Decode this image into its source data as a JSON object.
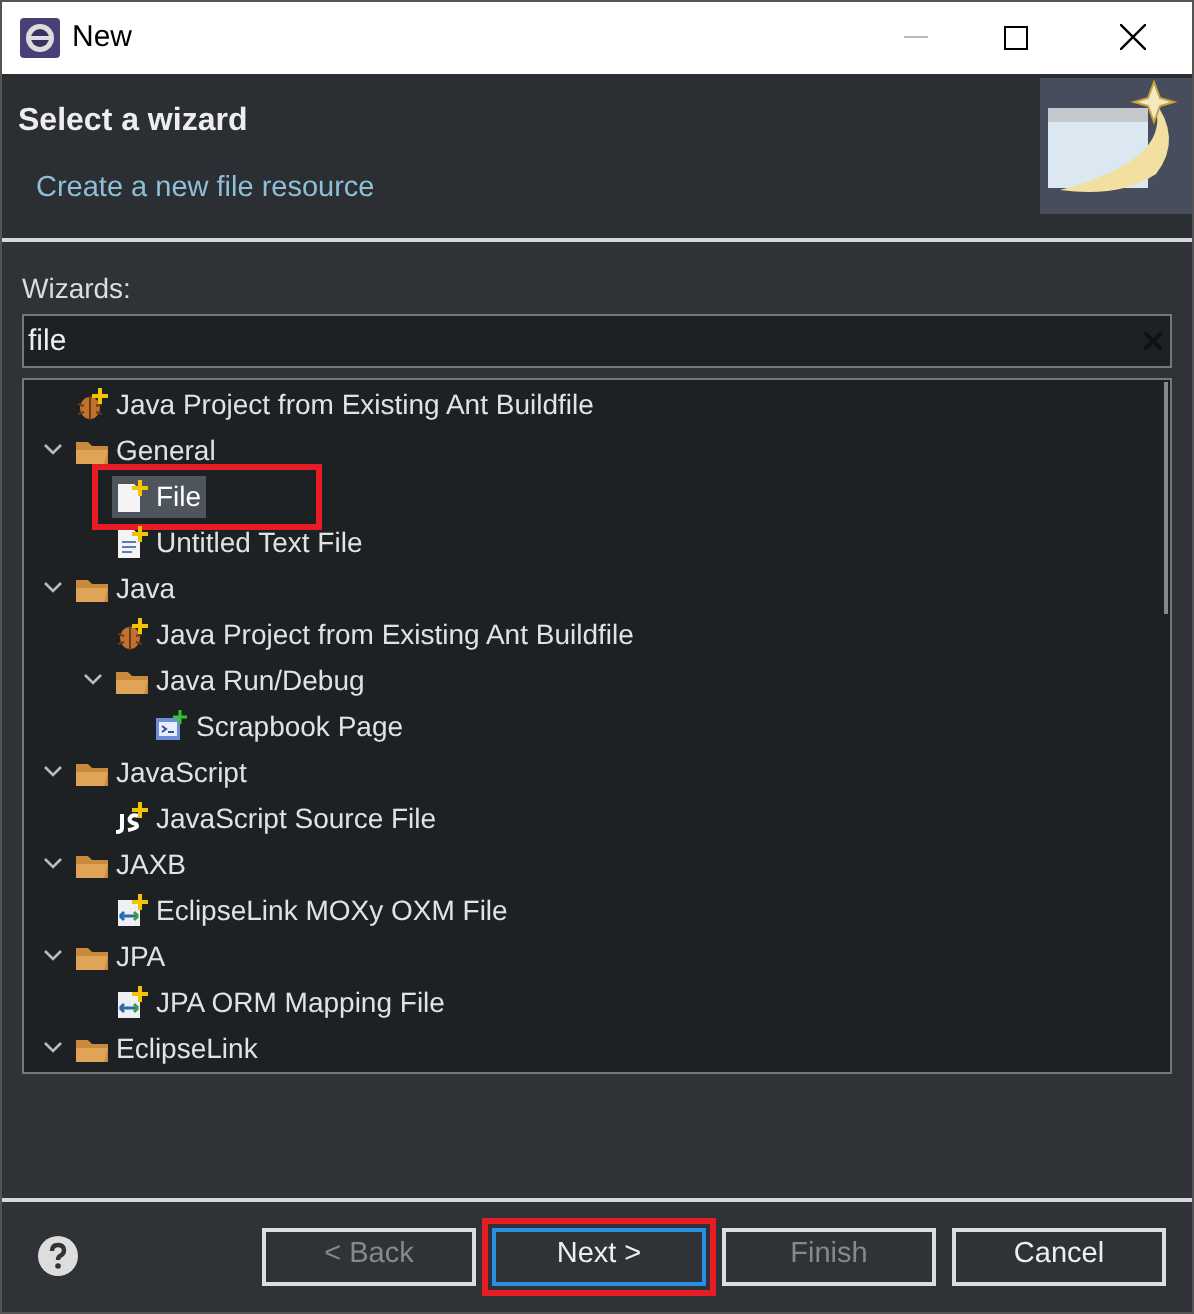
{
  "window": {
    "title": "New"
  },
  "header": {
    "title": "Select a wizard",
    "description": "Create a new file resource"
  },
  "wizards_label": "Wizards:",
  "filter": {
    "value": "file"
  },
  "tree": [
    {
      "label": "Java Project from Existing Ant Buildfile",
      "kind": "ant",
      "selected": false,
      "annotated": false
    },
    {
      "label": "General",
      "kind": "folder",
      "expanded": true,
      "selected": false,
      "annotated": false,
      "children": [
        {
          "label": "File",
          "kind": "file",
          "selected": true,
          "annotated": true
        },
        {
          "label": "Untitled Text File",
          "kind": "text",
          "selected": false,
          "annotated": false
        }
      ]
    },
    {
      "label": "Java",
      "kind": "folder",
      "expanded": true,
      "selected": false,
      "annotated": false,
      "children": [
        {
          "label": "Java Project from Existing Ant Buildfile",
          "kind": "ant",
          "selected": false,
          "annotated": false
        },
        {
          "label": "Java Run/Debug",
          "kind": "folder",
          "expanded": true,
          "selected": false,
          "annotated": false,
          "children": [
            {
              "label": "Scrapbook Page",
              "kind": "scrapbook",
              "selected": false,
              "annotated": false
            }
          ]
        }
      ]
    },
    {
      "label": "JavaScript",
      "kind": "folder",
      "expanded": true,
      "selected": false,
      "annotated": false,
      "children": [
        {
          "label": "JavaScript Source File",
          "kind": "js",
          "selected": false,
          "annotated": false
        }
      ]
    },
    {
      "label": "JAXB",
      "kind": "folder",
      "expanded": true,
      "selected": false,
      "annotated": false,
      "children": [
        {
          "label": "EclipseLink MOXy OXM File",
          "kind": "mapping",
          "selected": false,
          "annotated": false
        }
      ]
    },
    {
      "label": "JPA",
      "kind": "folder",
      "expanded": true,
      "selected": false,
      "annotated": false,
      "children": [
        {
          "label": "JPA ORM Mapping File",
          "kind": "mapping",
          "selected": false,
          "annotated": false
        }
      ]
    },
    {
      "label": "EclipseLink",
      "kind": "folder",
      "expanded": true,
      "selected": false,
      "annotated": false
    }
  ],
  "buttons": [
    {
      "label": "< Back",
      "disabled": true,
      "focused": false,
      "annotated": false
    },
    {
      "label": "Next >",
      "disabled": false,
      "focused": true,
      "annotated": true
    },
    {
      "label": "Finish",
      "disabled": true,
      "focused": false,
      "annotated": false
    },
    {
      "label": "Cancel",
      "disabled": false,
      "focused": false,
      "annotated": false
    }
  ]
}
